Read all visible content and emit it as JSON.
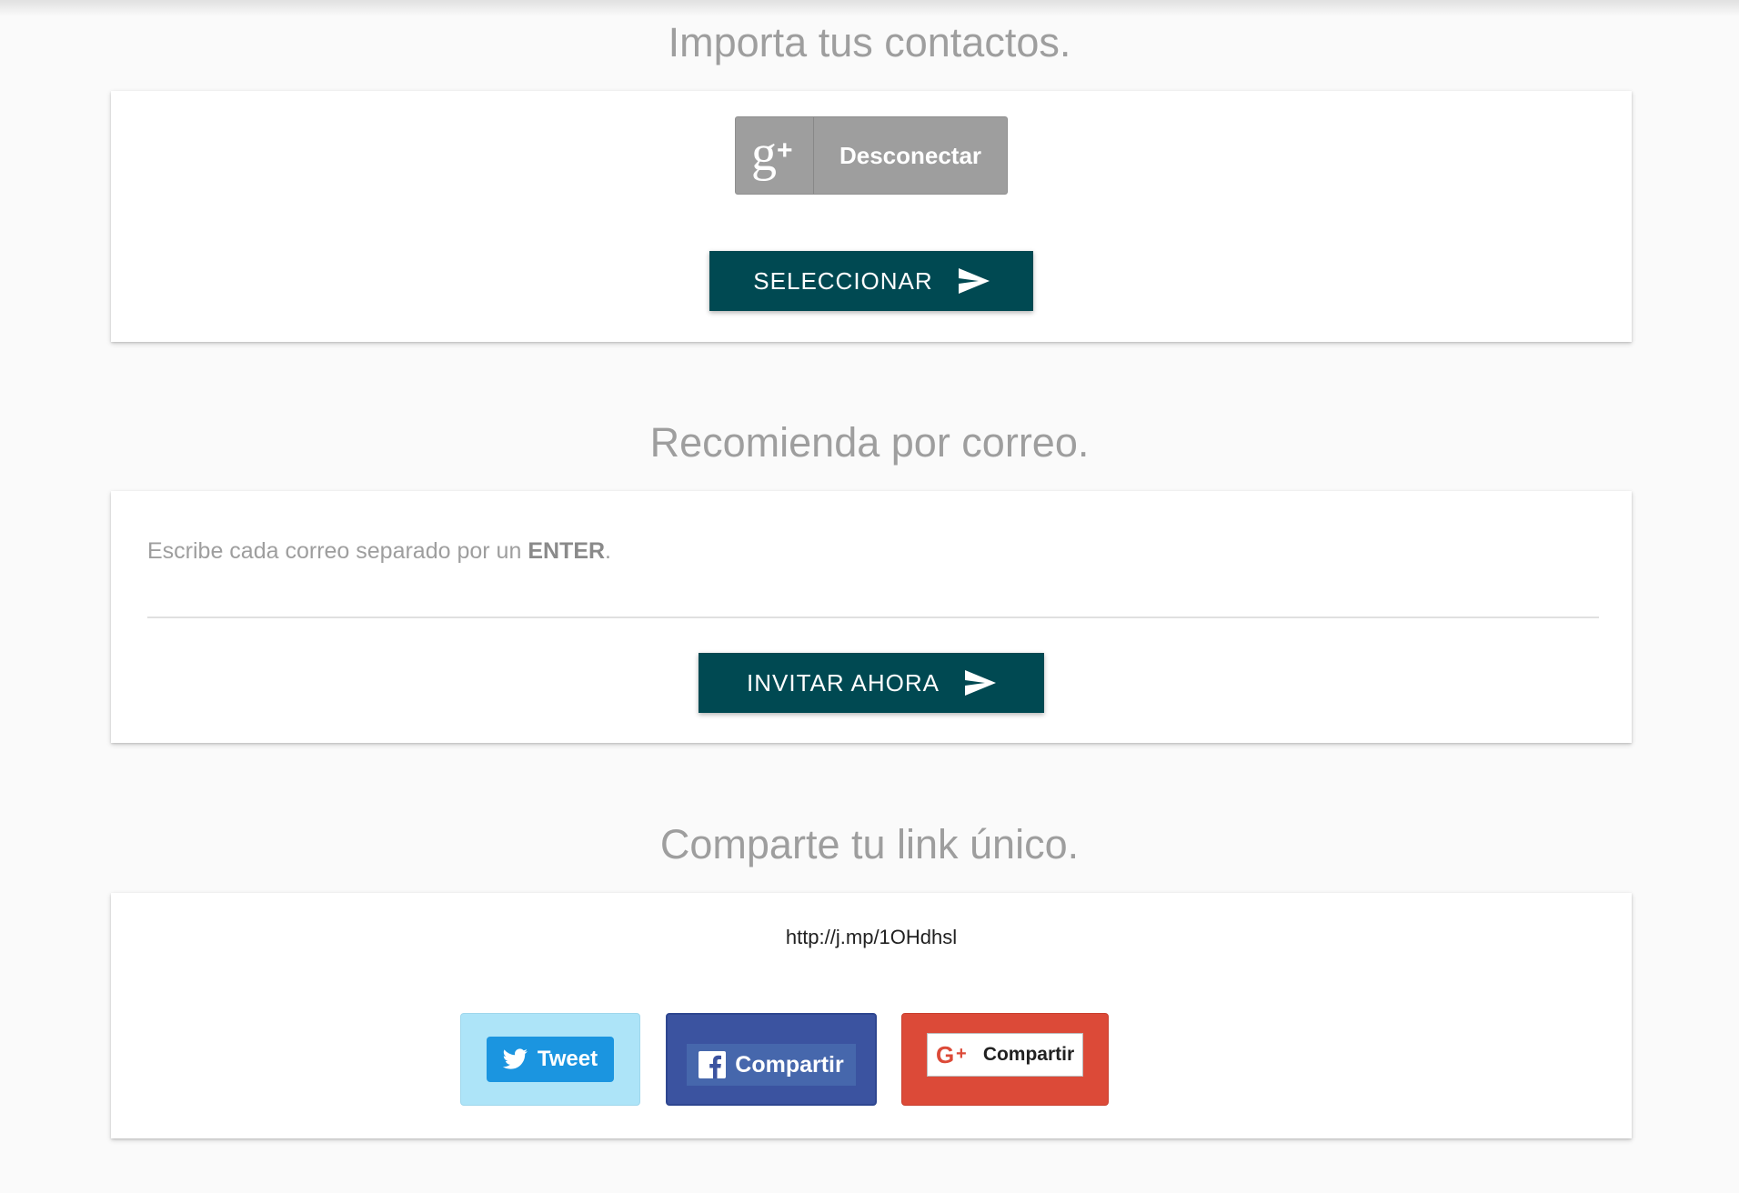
{
  "import_section": {
    "title": "Importa tus contactos.",
    "gplus_disconnect_label": "Desconectar",
    "select_button_label": "SELECCIONAR"
  },
  "email_section": {
    "title": "Recomienda por correo.",
    "hint_prefix": "Escribe cada correo separado por un ",
    "hint_key": "ENTER",
    "hint_suffix": ".",
    "email_input_value": "",
    "invite_button_label": "INVITAR AHORA"
  },
  "share_section": {
    "title": "Comparte tu link único.",
    "unique_link": "http://j.mp/1OHdhsl",
    "tweet_label": "Tweet",
    "facebook_label": "Compartir",
    "googleplus_label": "Compartir"
  },
  "colors": {
    "primary_button": "#004952",
    "title_gray": "#9e9e9e",
    "twitter_blue": "#1b95e0",
    "facebook_blue": "#3b53a0",
    "googleplus_red": "#dc4a38"
  },
  "icons": {
    "gplus_connect": "google-plus-icon",
    "send": "send-icon",
    "twitter": "twitter-bird-icon",
    "facebook": "facebook-f-icon",
    "googleplus_share": "google-plus-icon"
  }
}
